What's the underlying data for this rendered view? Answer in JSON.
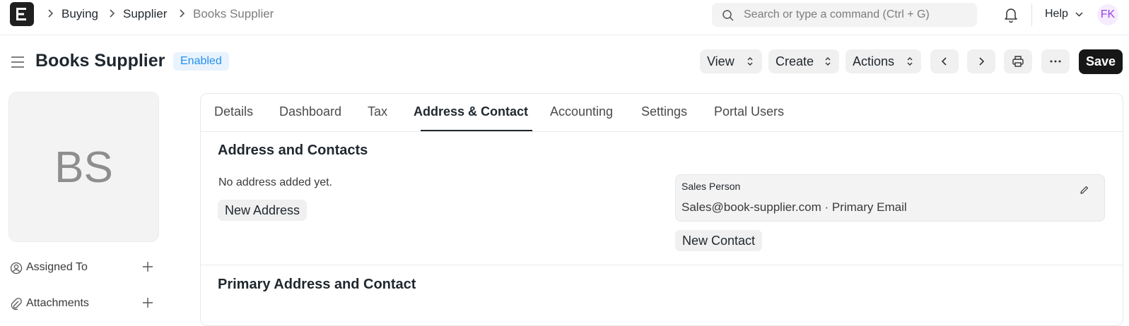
{
  "navbar": {
    "logo_letter": "E",
    "breadcrumbs": [
      "Buying",
      "Supplier",
      "Books Supplier"
    ],
    "search_placeholder": "Search or type a command (Ctrl + G)",
    "help_label": "Help",
    "user_initials": "FK"
  },
  "header": {
    "title": "Books Supplier",
    "status": "Enabled",
    "view_label": "View",
    "create_label": "Create",
    "actions_label": "Actions",
    "save_label": "Save"
  },
  "sidebar": {
    "avatar_initials": "BS",
    "assigned_to_label": "Assigned To",
    "attachments_label": "Attachments"
  },
  "tabs": [
    "Details",
    "Dashboard",
    "Tax",
    "Address & Contact",
    "Accounting",
    "Settings",
    "Portal Users"
  ],
  "active_tab": "Address & Contact",
  "address_section": {
    "title": "Address and Contacts",
    "no_address_text": "No address added yet.",
    "new_address_label": "New Address",
    "contact": {
      "name": "Sales Person",
      "email_line": "Sales@book-supplier.com · Primary Email"
    },
    "new_contact_label": "New Contact"
  },
  "primary_section": {
    "title": "Primary Address and Contact"
  },
  "colors": {
    "accent_dark": "#171717",
    "status_blue": "#2490ef",
    "status_bg": "#e8f3fd",
    "user_purple": "#9c45e3"
  }
}
